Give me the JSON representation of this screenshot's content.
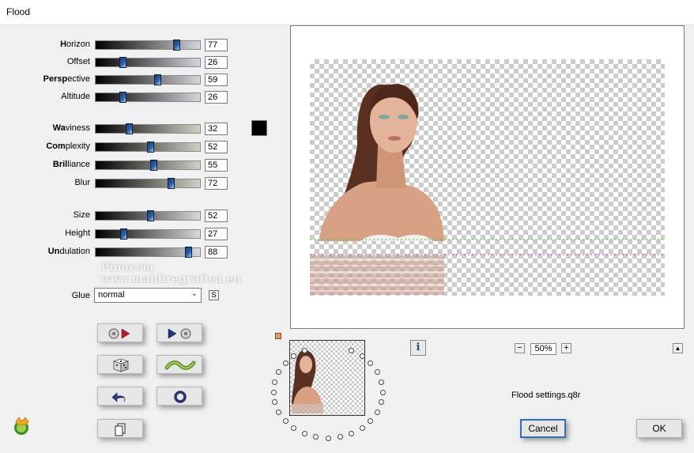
{
  "window": {
    "title": "Flood"
  },
  "sliders": [
    {
      "bold": "H",
      "rest": "orizon",
      "value": "77",
      "fraction": 0.77
    },
    {
      "bold": "",
      "rest": "Offset",
      "value": "26",
      "fraction": 0.26
    },
    {
      "bold": "Persp",
      "rest": "ective",
      "value": "59",
      "fraction": 0.59
    },
    {
      "bold": "",
      "rest": "Altitude",
      "value": "26",
      "fraction": 0.26
    },
    {
      "bold": "Wa",
      "rest": "viness",
      "value": "32",
      "fraction": 0.32
    },
    {
      "bold": "Com",
      "rest": "plexity",
      "value": "52",
      "fraction": 0.52
    },
    {
      "bold": "Bril",
      "rest": "liance",
      "value": "55",
      "fraction": 0.55
    },
    {
      "bold": "",
      "rest": "Blur",
      "value": "72",
      "fraction": 0.72
    },
    {
      "bold": "",
      "rest": "Size",
      "value": "52",
      "fraction": 0.52
    },
    {
      "bold": "",
      "rest": "Height",
      "value": "27",
      "fraction": 0.27
    },
    {
      "bold": "Un",
      "rest": "dulation",
      "value": "88",
      "fraction": 0.88
    }
  ],
  "color_swatch": "#000000",
  "glue": {
    "label": "Glue",
    "selected": "normal",
    "s_button": "S"
  },
  "watermark": {
    "line1": "Pinuccia",
    "line2": "www.maidiregrafica.eu"
  },
  "zoom": {
    "minus": "−",
    "value": "50%",
    "plus": "+"
  },
  "info_button": "i",
  "up_button": "▲",
  "settings_file": "Flood settings.q8r",
  "buttons": {
    "cancel": "Cancel",
    "ok": "OK"
  }
}
